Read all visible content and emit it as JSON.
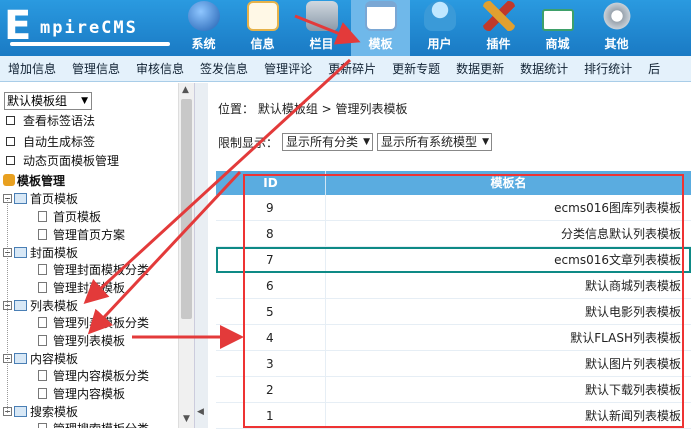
{
  "brand": {
    "logo_big": "E",
    "logo_small": "mpireCMS"
  },
  "nav": [
    {
      "label": "系统",
      "icon": "globe-icon",
      "color": "#3b7fd0"
    },
    {
      "label": "信息",
      "icon": "pencil-paper-icon",
      "color": "#e6b24a"
    },
    {
      "label": "栏目",
      "icon": "folder-icon",
      "color": "#9aa9b8"
    },
    {
      "label": "模板",
      "icon": "window-icon",
      "color": "#c0d8ef"
    },
    {
      "label": "用户",
      "icon": "user-icon",
      "color": "#4ab0e0"
    },
    {
      "label": "插件",
      "icon": "tools-icon",
      "color": "#e0a030"
    },
    {
      "label": "商城",
      "icon": "card-icon",
      "color": "#3ea06a"
    },
    {
      "label": "其他",
      "icon": "gear-icon",
      "color": "#b0b8c0"
    }
  ],
  "subnav": [
    "增加信息",
    "管理信息",
    "审核信息",
    "签发信息",
    "管理评论",
    "更新碎片",
    "更新专题",
    "数据更新",
    "数据统计",
    "排行统计",
    "后"
  ],
  "sidebar": {
    "select_value": "默认模板组",
    "links": [
      "查看标签语法",
      "自动生成标签",
      "动态页面模板管理"
    ],
    "root": "模板管理",
    "groups": [
      {
        "label": "首页模板",
        "children": [
          "首页模板",
          "管理首页方案"
        ]
      },
      {
        "label": "封面模板",
        "children": [
          "管理封面模板分类",
          "管理封面模板"
        ]
      },
      {
        "label": "列表模板",
        "children": [
          "管理列表模板分类",
          "管理列表模板"
        ]
      },
      {
        "label": "内容模板",
        "children": [
          "管理内容模板分类",
          "管理内容模板"
        ]
      },
      {
        "label": "搜索模板",
        "children": [
          "管理搜索模板分类"
        ]
      }
    ]
  },
  "main": {
    "breadcrumb": "位置： 默认模板组 > 管理列表模板",
    "filter_label": "限制显示：",
    "filter_class": "显示所有分类",
    "filter_model": "显示所有系统模型",
    "table": {
      "headers": [
        "ID",
        "模板名"
      ],
      "rows": [
        {
          "id": "9",
          "name": "ecms016图库列表模板"
        },
        {
          "id": "8",
          "name": "分类信息默认列表模板"
        },
        {
          "id": "7",
          "name": "ecms016文章列表模板"
        },
        {
          "id": "6",
          "name": "默认商城列表模板"
        },
        {
          "id": "5",
          "name": "默认电影列表模板"
        },
        {
          "id": "4",
          "name": "默认FLASH列表模板"
        },
        {
          "id": "3",
          "name": "默认图片列表模板"
        },
        {
          "id": "2",
          "name": "默认下载列表模板"
        },
        {
          "id": "1",
          "name": "默认新闻列表模板"
        }
      ]
    }
  },
  "annotation_color": "#e33a3a"
}
